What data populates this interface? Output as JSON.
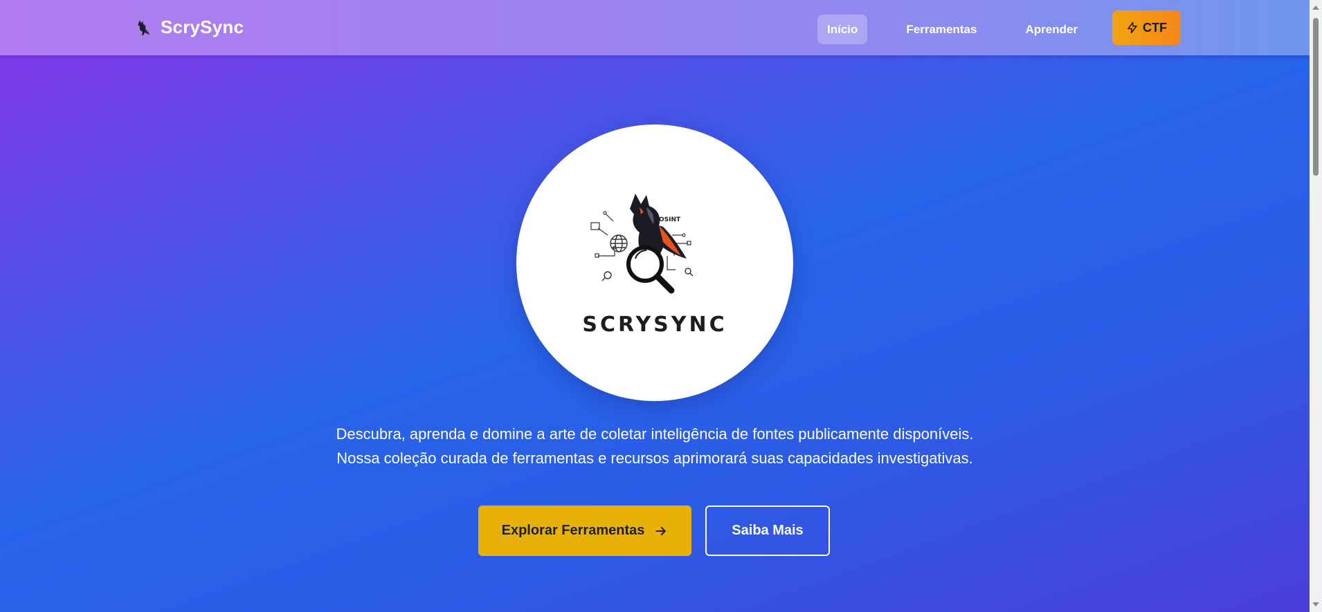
{
  "header": {
    "brand_name": "ScrySync",
    "brand_icon": "fox-icon",
    "nav": [
      {
        "label": "Início",
        "active": true
      },
      {
        "label": "Ferramentas",
        "active": false
      },
      {
        "label": "Aprender",
        "active": false
      }
    ],
    "ctf": {
      "label": "CTF",
      "icon": "lightning-bolt-icon"
    }
  },
  "hero": {
    "logo_text": "SCRYSYNC",
    "logo_badge": "OSINT",
    "description_lines": [
      "Descubra, aprenda e domine a arte de coletar inteligência de fontes publicamente disponíveis.",
      "Nossa coleção curada de ferramentas e recursos aprimorará suas capacidades investigativas."
    ],
    "primary_button": {
      "label": "Explorar Ferramentas",
      "icon": "arrow-right-icon"
    },
    "secondary_button": {
      "label": "Saiba Mais"
    }
  },
  "colors": {
    "accent_yellow": "#e7b106",
    "ctf_orange": "#f6861a",
    "gradient_start": "#8a35ea",
    "gradient_mid": "#2764ea"
  }
}
